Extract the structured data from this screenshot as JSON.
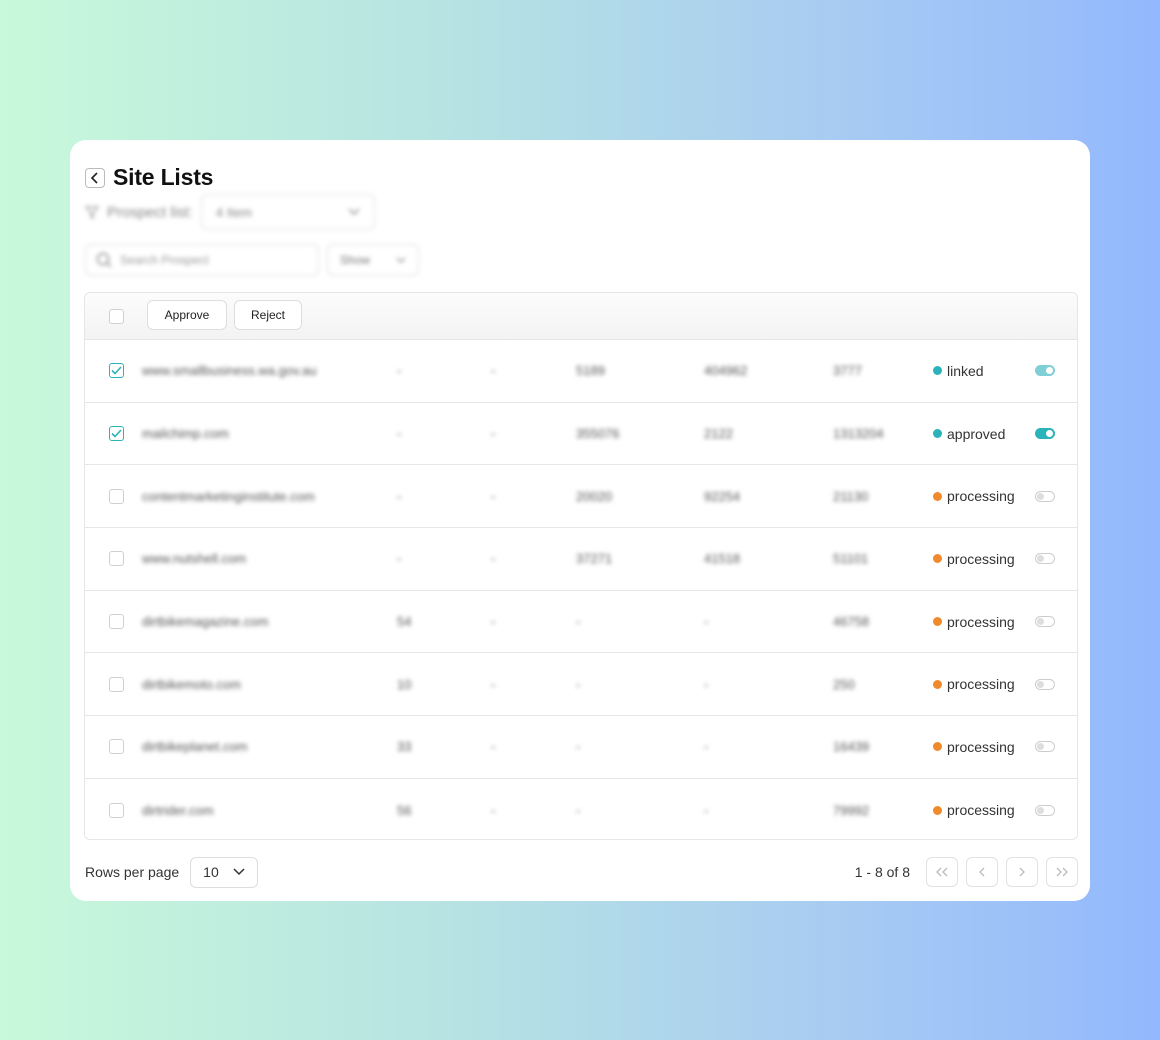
{
  "page": {
    "title": "Site Lists",
    "prospect_label": "Prospect list:",
    "prospect_value": "4 Item",
    "search_placeholder": "Search Prospect",
    "show_label": "Show"
  },
  "toolbar": {
    "approve_label": "Approve",
    "reject_label": "Reject"
  },
  "rows": [
    {
      "site": "www.smallbusiness.wa.gov.au",
      "a": "-",
      "b": "-",
      "c": "5189",
      "d": "404962",
      "e": "3777",
      "status": "linked",
      "status_color": "#2ab3b8",
      "checked": true,
      "toggle": "partial"
    },
    {
      "site": "mailchimp.com",
      "a": "-",
      "b": "-",
      "c": "355076",
      "d": "2122",
      "e": "1313204",
      "status": "approved",
      "status_color": "#2ab3b8",
      "checked": true,
      "toggle": "on"
    },
    {
      "site": "contentmarketinginstitute.com",
      "a": "-",
      "b": "-",
      "c": "20020",
      "d": "92254",
      "e": "21130",
      "status": "processing",
      "status_color": "#f08a2c",
      "checked": false,
      "toggle": "off"
    },
    {
      "site": "www.nutshell.com",
      "a": "-",
      "b": "-",
      "c": "37271",
      "d": "41518",
      "e": "51101",
      "status": "processing",
      "status_color": "#f08a2c",
      "checked": false,
      "toggle": "off"
    },
    {
      "site": "dirtbikemagazine.com",
      "a": "54",
      "b": "-",
      "c": "-",
      "d": "-",
      "e": "46758",
      "status": "processing",
      "status_color": "#f08a2c",
      "checked": false,
      "toggle": "off"
    },
    {
      "site": "dirtbikemoto.com",
      "a": "10",
      "b": "-",
      "c": "-",
      "d": "-",
      "e": "250",
      "status": "processing",
      "status_color": "#f08a2c",
      "checked": false,
      "toggle": "off"
    },
    {
      "site": "dirtbikeplanet.com",
      "a": "33",
      "b": "-",
      "c": "-",
      "d": "-",
      "e": "16439",
      "status": "processing",
      "status_color": "#f08a2c",
      "checked": false,
      "toggle": "off"
    },
    {
      "site": "dirtrider.com",
      "a": "56",
      "b": "-",
      "c": "-",
      "d": "-",
      "e": "79992",
      "status": "processing",
      "status_color": "#f08a2c",
      "checked": false,
      "toggle": "off"
    }
  ],
  "footer": {
    "rows_per_page_label": "Rows per page",
    "rows_per_page_value": "10",
    "range_text": "1 - 8 of 8"
  },
  "icons": {
    "back": "chevron-left-icon",
    "filter": "filter-icon",
    "search": "search-icon",
    "first": "chevrons-left-icon",
    "prev": "chevron-left-icon",
    "next": "chevron-right-icon",
    "last": "chevrons-right-icon"
  }
}
